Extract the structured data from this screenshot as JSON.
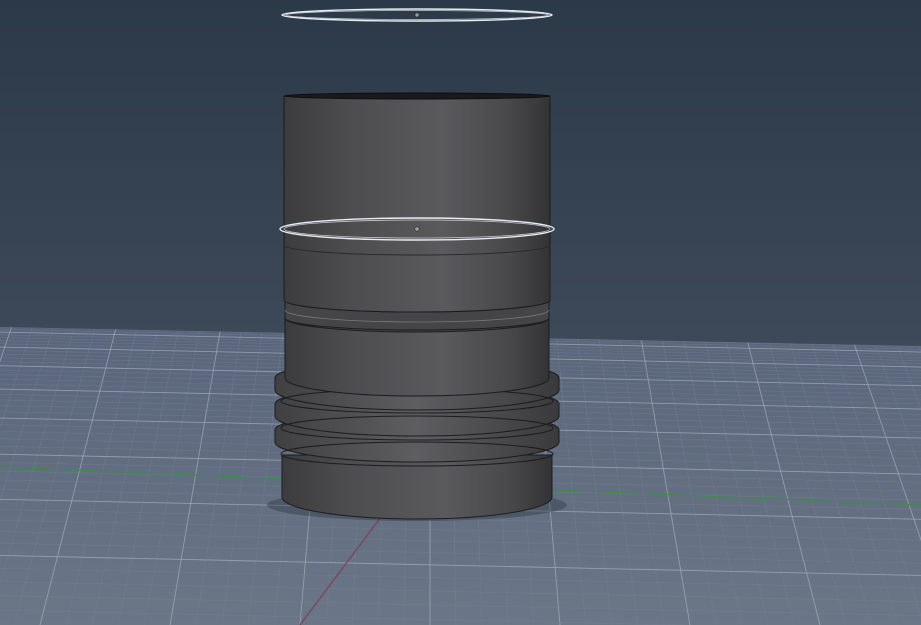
{
  "viewport": {
    "kind": "3d-modeling-viewport",
    "background_top_color": "#2c3949",
    "background_bottom_color": "#4a5665",
    "grid_plane_color": "#5f6b7b",
    "grid_minor_line_color": "#7a8696",
    "grid_major_line_color": "#a3aebb",
    "x_axis_color": "#7b4a5a",
    "y_axis_color": "#3f8a4e"
  },
  "scene": {
    "object": {
      "name_hint": "cylindrical-pipe-fitting",
      "shape": "cylinder-with-ribs",
      "body_color": "#4a4a4c",
      "outline_color": "#1c1c1e",
      "ribs_count": 3,
      "groove_count": 2
    },
    "selected_edge_loops": [
      {
        "id": "loop-floating-top",
        "highlight_color": "#e9edf2",
        "has_pivot_dot": true
      },
      {
        "id": "loop-on-body",
        "highlight_color": "#e9edf2",
        "has_pivot_dot": true
      }
    ]
  }
}
